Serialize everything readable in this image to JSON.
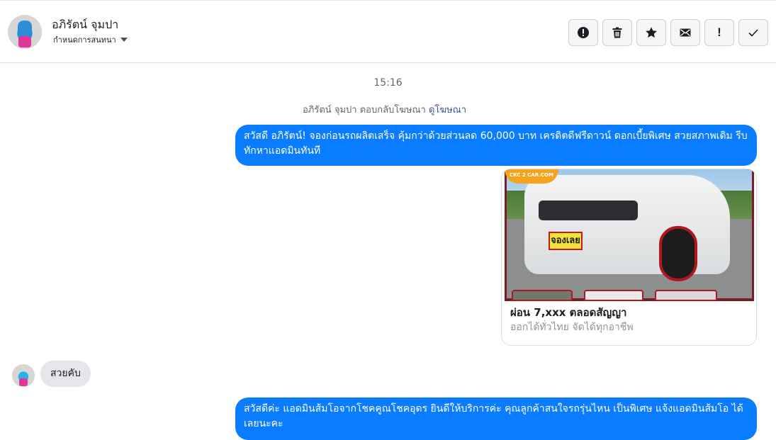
{
  "header": {
    "contact_name": "อภิรัตน์ จุมปา",
    "assign_label": "กำหนดการสนทนา",
    "actions": [
      {
        "name": "report-spam-button",
        "icon": "exclamation-circle-icon"
      },
      {
        "name": "delete-button",
        "icon": "trash-icon"
      },
      {
        "name": "star-button",
        "icon": "star-icon"
      },
      {
        "name": "mark-unread-button",
        "icon": "envelope-icon"
      },
      {
        "name": "follow-up-button",
        "icon": "exclamation-icon",
        "glyph": "!"
      },
      {
        "name": "mark-done-button",
        "icon": "check-icon"
      }
    ]
  },
  "conversation": {
    "timestamp": "15:16",
    "reply_note": "อภิรัตน์ จุมปา ตอบกลับโฆษณา",
    "reply_link": "ดูโฆษณา",
    "messages": [
      {
        "direction": "outgoing",
        "text": "สวัสดี อภิรัตน์! จองก่อนรถผลิตเสร็จ คุ้มกว่าด้วยส่วนลด 60,000 บาท เครดิตดีฟรีดาวน์ ดอกเบี้ยพิเศษ สวยสภาพเดิม รีบทักหาแอดมินทันที"
      },
      {
        "direction": "outgoing",
        "type": "ad_card",
        "image_logo": "CKC 2 CAR.COM",
        "image_plate": "จองเลย",
        "title": "ผ่อน 7,xxx ตลอดสัญญา",
        "description": "ออกได้ทั่วไทย จัดได้ทุกอาชีพ"
      },
      {
        "direction": "incoming",
        "text": "สวยคับ"
      },
      {
        "direction": "outgoing",
        "text": "สวัสดีค่ะ แอดมินส้มโอจากโชคคูณโชคอุดร ยินดีให้บริการค่ะ   คุณลูกค้าสนใจรถรุ่นไหน เป็นพิเศษ แจ้งแอดมินส้มโอ ได้เลยนะคะ"
      }
    ]
  },
  "colors": {
    "outgoing_bubble": "#0a7cff",
    "incoming_bubble": "#e4e6eb",
    "link": "#385898"
  }
}
